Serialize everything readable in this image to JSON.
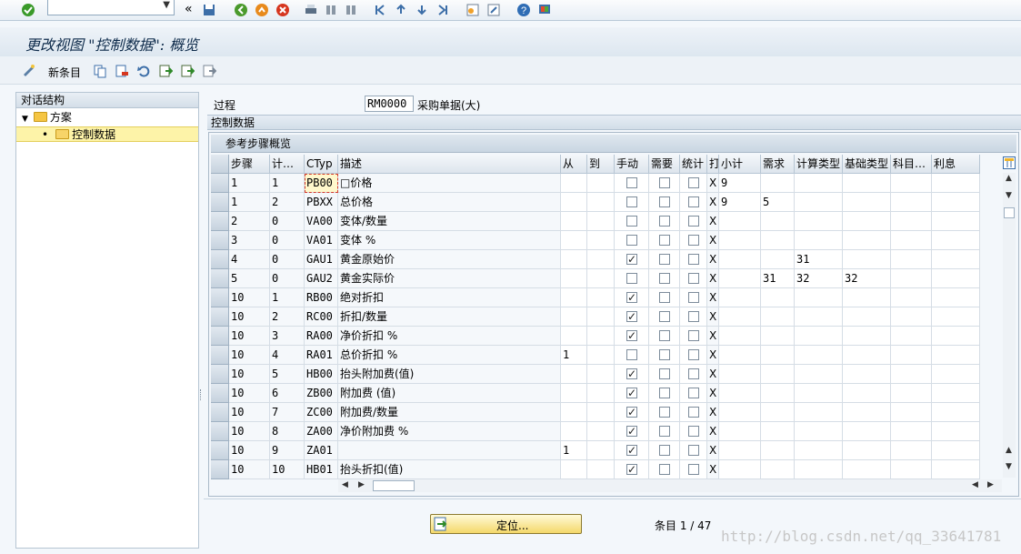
{
  "window_title": "更改视图 \"控制数据\": 概览",
  "toolbar": {
    "back_label": "«"
  },
  "app_toolbar": {
    "new_entries": "新条目"
  },
  "tree": {
    "header": "对话结构",
    "nodes": [
      {
        "label": "方案",
        "toggle": "▼"
      },
      {
        "label": "控制数据",
        "bullet": "•"
      }
    ]
  },
  "process_field": {
    "label": "过程",
    "value": "RM0000",
    "description": "采购单据(大)"
  },
  "section_title": "控制数据",
  "panel_title": "参考步骤概览",
  "columns": [
    "步骤",
    "计…",
    "CTyp",
    "描述",
    "从",
    "到",
    "手动",
    "需要",
    "统计",
    "打",
    "小计",
    "需求",
    "计算类型",
    "基础类型",
    "科目…",
    "利息"
  ],
  "rows": [
    {
      "step": "1",
      "counter": "1",
      "ctyp": "PB00",
      "desc": "□价格",
      "from": "",
      "to": "",
      "manual": false,
      "required": false,
      "stat": false,
      "print": "X",
      "subtotal": "9",
      "req": "",
      "calc": "",
      "base": "",
      "acct": "",
      "accrual": ""
    },
    {
      "step": "1",
      "counter": "2",
      "ctyp": "PBXX",
      "desc": "总价格",
      "from": "",
      "to": "",
      "manual": false,
      "required": false,
      "stat": false,
      "print": "X",
      "subtotal": "9",
      "req": "5",
      "calc": "",
      "base": "",
      "acct": "",
      "accrual": ""
    },
    {
      "step": "2",
      "counter": "0",
      "ctyp": "VA00",
      "desc": "变体/数量",
      "from": "",
      "to": "",
      "manual": false,
      "required": false,
      "stat": false,
      "print": "X",
      "subtotal": "",
      "req": "",
      "calc": "",
      "base": "",
      "acct": "",
      "accrual": ""
    },
    {
      "step": "3",
      "counter": "0",
      "ctyp": "VA01",
      "desc": "变体 %",
      "from": "",
      "to": "",
      "manual": false,
      "required": false,
      "stat": false,
      "print": "X",
      "subtotal": "",
      "req": "",
      "calc": "",
      "base": "",
      "acct": "",
      "accrual": ""
    },
    {
      "step": "4",
      "counter": "0",
      "ctyp": "GAU1",
      "desc": "黄金原始价",
      "from": "",
      "to": "",
      "manual": true,
      "required": false,
      "stat": false,
      "print": "X",
      "subtotal": "",
      "req": "",
      "calc": "31",
      "base": "",
      "acct": "",
      "accrual": ""
    },
    {
      "step": "5",
      "counter": "0",
      "ctyp": "GAU2",
      "desc": "黄金实际价",
      "from": "",
      "to": "",
      "manual": false,
      "required": false,
      "stat": false,
      "print": "X",
      "subtotal": "",
      "req": "31",
      "calc": "32",
      "base": "32",
      "acct": "",
      "accrual": ""
    },
    {
      "step": "10",
      "counter": "1",
      "ctyp": "RB00",
      "desc": "绝对折扣",
      "from": "",
      "to": "",
      "manual": true,
      "required": false,
      "stat": false,
      "print": "X",
      "subtotal": "",
      "req": "",
      "calc": "",
      "base": "",
      "acct": "",
      "accrual": ""
    },
    {
      "step": "10",
      "counter": "2",
      "ctyp": "RC00",
      "desc": "折扣/数量",
      "from": "",
      "to": "",
      "manual": true,
      "required": false,
      "stat": false,
      "print": "X",
      "subtotal": "",
      "req": "",
      "calc": "",
      "base": "",
      "acct": "",
      "accrual": ""
    },
    {
      "step": "10",
      "counter": "3",
      "ctyp": "RA00",
      "desc": "净价折扣 %",
      "from": "",
      "to": "",
      "manual": true,
      "required": false,
      "stat": false,
      "print": "X",
      "subtotal": "",
      "req": "",
      "calc": "",
      "base": "",
      "acct": "",
      "accrual": ""
    },
    {
      "step": "10",
      "counter": "4",
      "ctyp": "RA01",
      "desc": "总价折扣 %",
      "from": "1",
      "to": "",
      "manual": false,
      "required": false,
      "stat": false,
      "print": "X",
      "subtotal": "",
      "req": "",
      "calc": "",
      "base": "",
      "acct": "",
      "accrual": ""
    },
    {
      "step": "10",
      "counter": "5",
      "ctyp": "HB00",
      "desc": "抬头附加费(值)",
      "from": "",
      "to": "",
      "manual": true,
      "required": false,
      "stat": false,
      "print": "X",
      "subtotal": "",
      "req": "",
      "calc": "",
      "base": "",
      "acct": "",
      "accrual": ""
    },
    {
      "step": "10",
      "counter": "6",
      "ctyp": "ZB00",
      "desc": "附加费 (值)",
      "from": "",
      "to": "",
      "manual": true,
      "required": false,
      "stat": false,
      "print": "X",
      "subtotal": "",
      "req": "",
      "calc": "",
      "base": "",
      "acct": "",
      "accrual": ""
    },
    {
      "step": "10",
      "counter": "7",
      "ctyp": "ZC00",
      "desc": "附加费/数量",
      "from": "",
      "to": "",
      "manual": true,
      "required": false,
      "stat": false,
      "print": "X",
      "subtotal": "",
      "req": "",
      "calc": "",
      "base": "",
      "acct": "",
      "accrual": ""
    },
    {
      "step": "10",
      "counter": "8",
      "ctyp": "ZA00",
      "desc": "净价附加费 %",
      "from": "",
      "to": "",
      "manual": true,
      "required": false,
      "stat": false,
      "print": "X",
      "subtotal": "",
      "req": "",
      "calc": "",
      "base": "",
      "acct": "",
      "accrual": ""
    },
    {
      "step": "10",
      "counter": "9",
      "ctyp": "ZA01",
      "desc": "",
      "from": "1",
      "to": "",
      "manual": true,
      "required": false,
      "stat": false,
      "print": "X",
      "subtotal": "",
      "req": "",
      "calc": "",
      "base": "",
      "acct": "",
      "accrual": ""
    },
    {
      "step": "10",
      "counter": "10",
      "ctyp": "HB01",
      "desc": "抬头折扣(值)",
      "from": "",
      "to": "",
      "manual": true,
      "required": false,
      "stat": false,
      "print": "X",
      "subtotal": "",
      "req": "",
      "calc": "",
      "base": "",
      "acct": "",
      "accrual": ""
    }
  ],
  "locate_button": "定位...",
  "entry_count": "条目 1 / 47",
  "watermark": "http://blog.csdn.net/qq_33641781"
}
